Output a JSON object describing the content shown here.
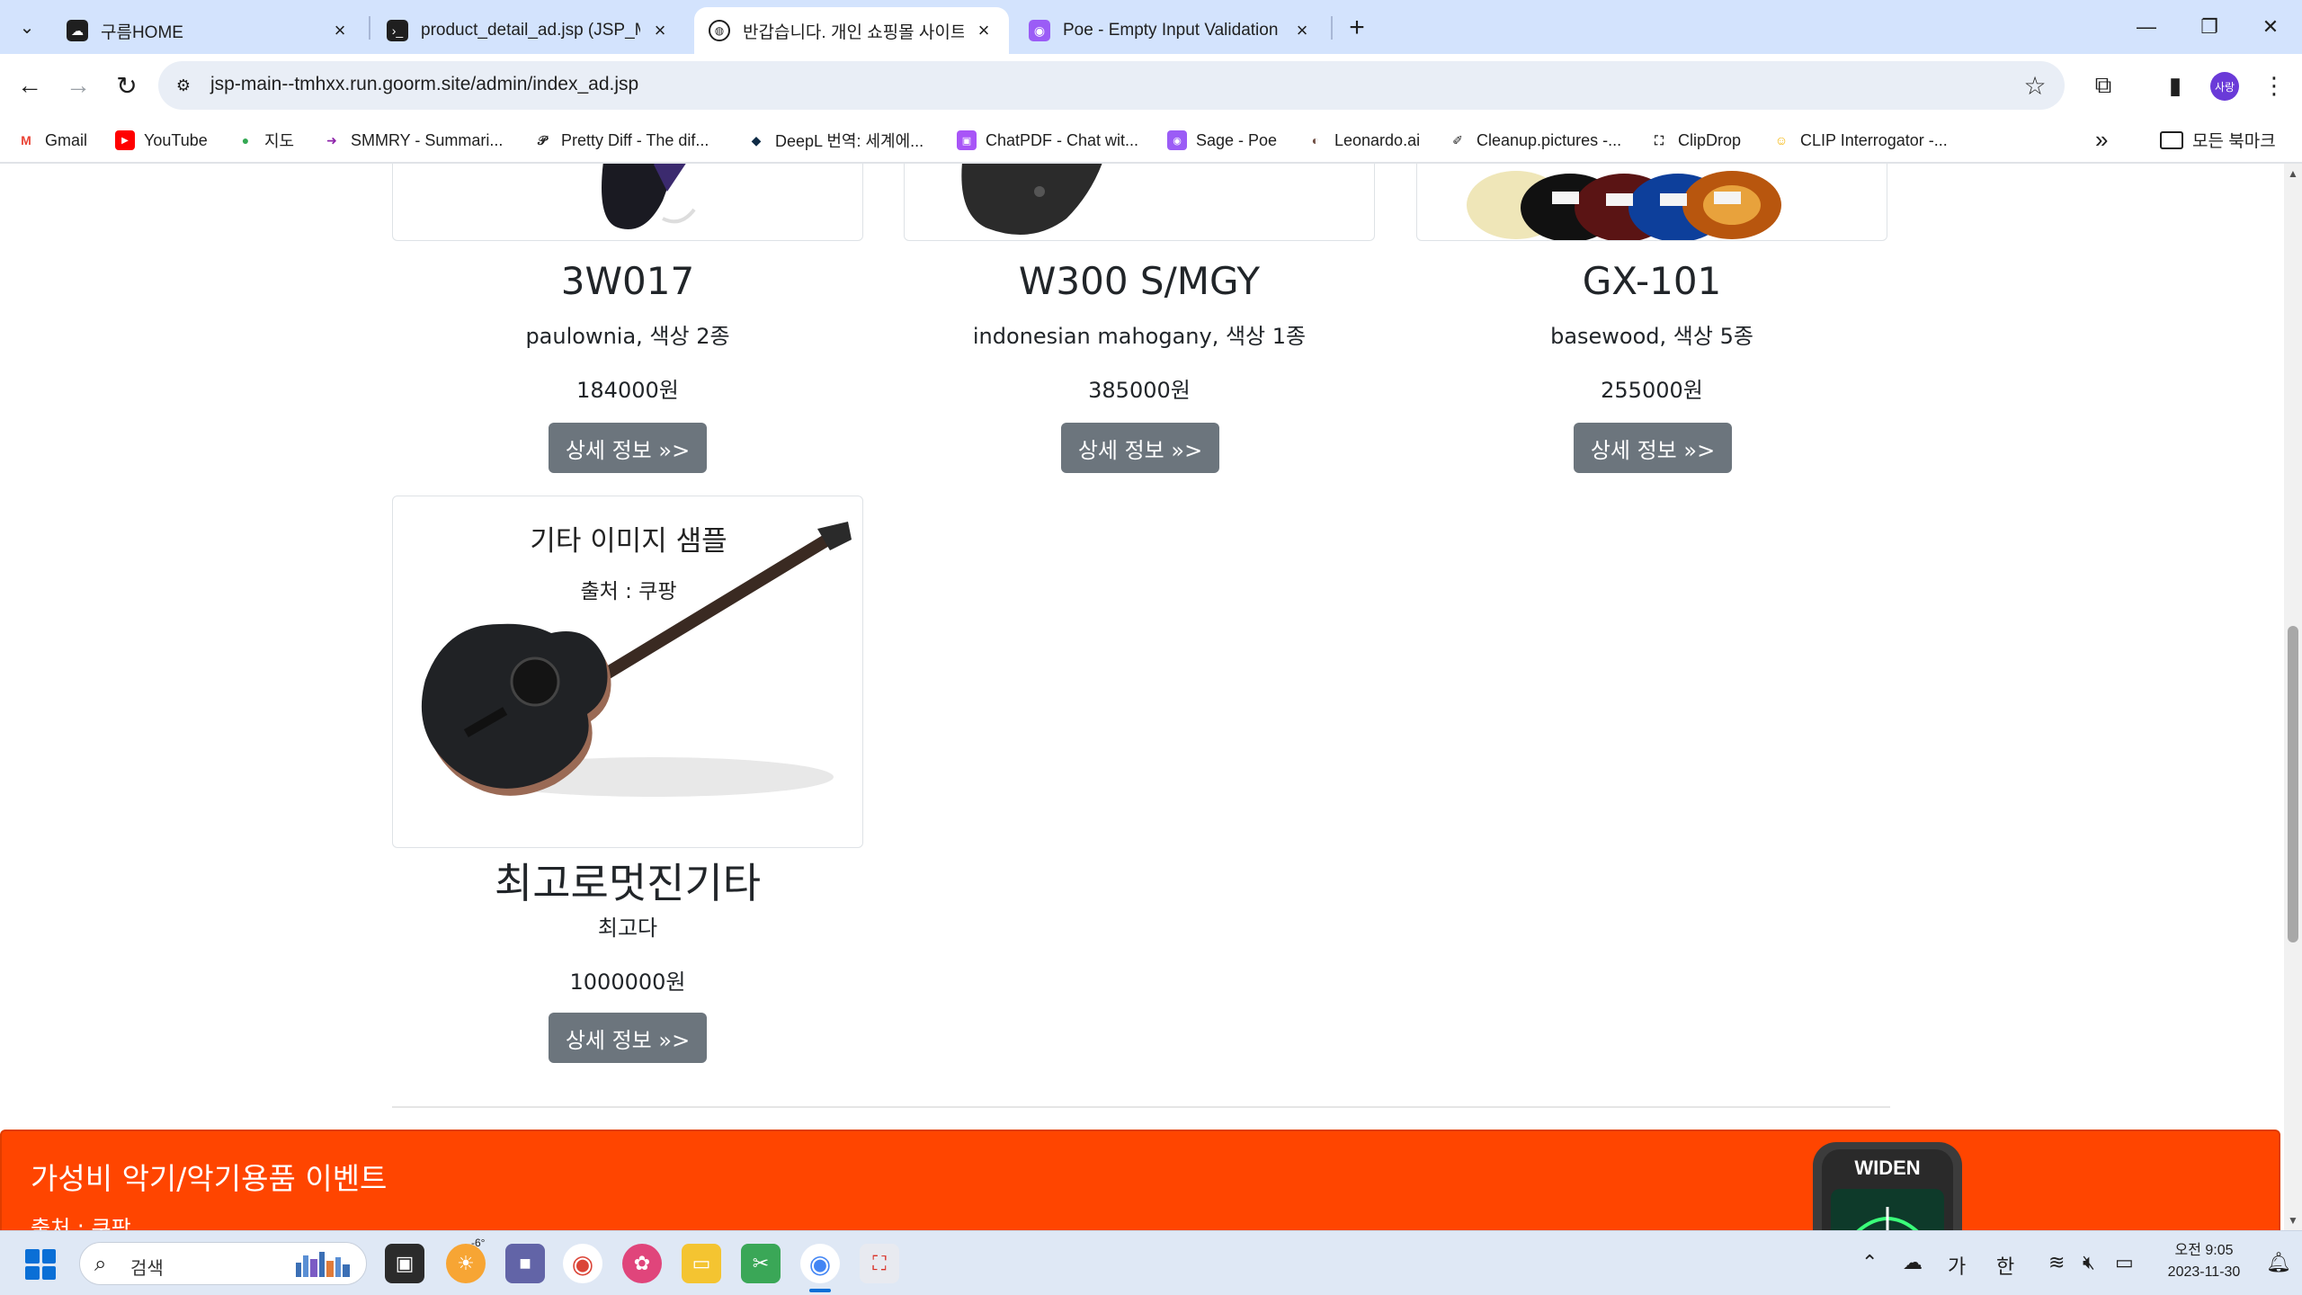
{
  "browser": {
    "tabs": [
      {
        "title": "구름HOME",
        "active": false,
        "favicon": "goorm-cloud-icon"
      },
      {
        "title": "product_detail_ad.jsp (JSP_MAI",
        "active": false,
        "favicon": "terminal-icon"
      },
      {
        "title": "반갑습니다. 개인 쇼핑몰 사이트",
        "active": true,
        "favicon": "globe-icon"
      },
      {
        "title": "Poe - Empty Input Validation",
        "active": false,
        "favicon": "poe-icon"
      }
    ],
    "url": "jsp-main--tmhxx.run.goorm.site/admin/index_ad.jsp",
    "profile_label": "사랑",
    "bookmarks": [
      {
        "label": "Gmail",
        "icon": "gmail-icon"
      },
      {
        "label": "YouTube",
        "icon": "youtube-icon"
      },
      {
        "label": "지도",
        "icon": "maps-pin-icon"
      },
      {
        "label": "SMMRY - Summari...",
        "icon": "arrow-icon"
      },
      {
        "label": "Pretty Diff - The dif...",
        "icon": "pretty-diff-icon"
      },
      {
        "label": "DeepL 번역: 세계에...",
        "icon": "deepl-icon"
      },
      {
        "label": "ChatPDF - Chat wit...",
        "icon": "chatpdf-icon"
      },
      {
        "label": "Sage - Poe",
        "icon": "poe-icon"
      },
      {
        "label": "Leonardo.ai",
        "icon": "leonardo-icon"
      },
      {
        "label": "Cleanup.pictures -...",
        "icon": "cleanup-icon"
      },
      {
        "label": "ClipDrop",
        "icon": "clipdrop-icon"
      },
      {
        "label": "CLIP Interrogator -...",
        "icon": "hugging-face-icon"
      }
    ],
    "all_bookmarks_label": "모든 북마크",
    "overflow_label": "»"
  },
  "products_row1": [
    {
      "name": "3W017",
      "desc": "paulownia, 색상 2종",
      "price": "184000원",
      "button": "상세 정보 »>"
    },
    {
      "name": "W300 S/MGY",
      "desc": "indonesian mahogany, 색상 1종",
      "price": "385000원",
      "button": "상세 정보 »>"
    },
    {
      "name": "GX-101",
      "desc": "basewood, 색상 5종",
      "price": "255000원",
      "button": "상세 정보 »>"
    }
  ],
  "product_row2": {
    "image_title": "기타 이미지 샘플",
    "image_source": "출처 : 쿠팡",
    "name": "최고로멋진기타",
    "desc": "최고다",
    "price": "1000000원",
    "button": "상세 정보 »>"
  },
  "banner": {
    "title": "가성비 악기/악기용품 이벤트",
    "source": "출처 : 쿠팡",
    "tuner_brand": "WIDEN",
    "color": "#ff4500"
  },
  "taskbar": {
    "search_placeholder": "검색",
    "weather": "-6°",
    "ime_mode": "가",
    "ime_lang": "한",
    "time": "오전 9:05",
    "date": "2023-11-30"
  }
}
